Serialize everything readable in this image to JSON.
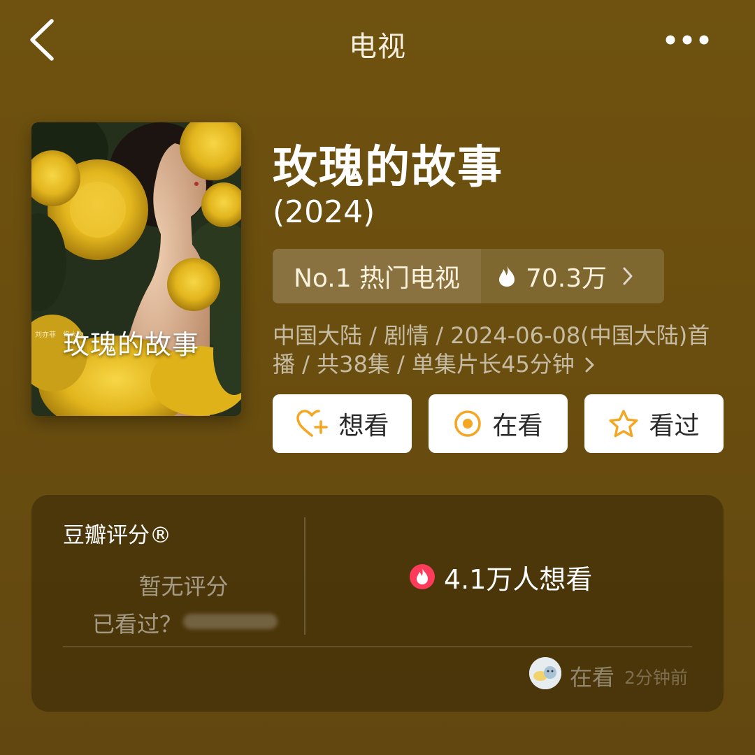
{
  "nav": {
    "title": "电视",
    "back_icon": "chevron-left-icon",
    "more_icon": "more-dots-icon"
  },
  "poster": {
    "overlay_title": "玫瑰的故事",
    "credits": "刘亦菲　佟大为"
  },
  "show": {
    "title": "玫瑰的故事",
    "year": "(2024)",
    "rank_label": "No.1 热门电视",
    "hot_count": "70.3万",
    "meta_line1": "中国大陆 / 剧情 / 2024-06-08(中国大陆)首",
    "meta_line2": "播 / 共38集 / 单集片长45分钟"
  },
  "actions": [
    {
      "label": "想看",
      "icon": "heart-plus-icon"
    },
    {
      "label": "在看",
      "icon": "target-circle-icon"
    },
    {
      "label": "看过",
      "icon": "star-outline-icon"
    }
  ],
  "rating": {
    "title": "豆瓣评分®",
    "no_rating": "暂无评分",
    "watched_prompt": "已看过？",
    "want_count": "4.1万人想看"
  },
  "activity": {
    "status": "在看",
    "time": "2分钟前"
  },
  "colors": {
    "background": "#6a4e0f",
    "accent": "#f5a623",
    "want_badge": "#ff3b5c"
  }
}
